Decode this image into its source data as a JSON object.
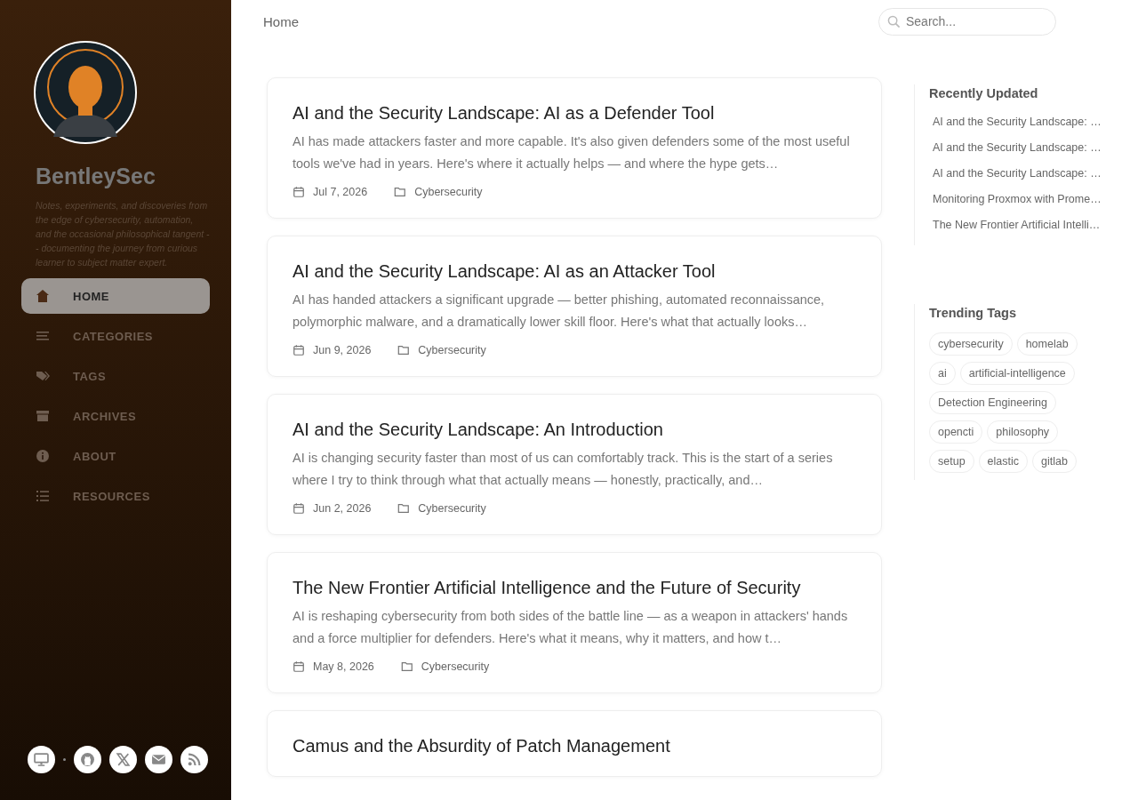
{
  "sidebar": {
    "site_title": "BentleySec",
    "tagline": "Notes, experiments, and discoveries from the edge of cybersecurity, automation, and the occasional philosophical tangent -- documenting the journey from curious learner to subject matter expert.",
    "nav": [
      {
        "kind": "home",
        "label": "HOME",
        "selected": true
      },
      {
        "kind": "categories",
        "label": "CATEGORIES",
        "selected": false
      },
      {
        "kind": "tags",
        "label": "TAGS",
        "selected": false
      },
      {
        "kind": "archives",
        "label": "ARCHIVES",
        "selected": false
      },
      {
        "kind": "about",
        "label": "ABOUT",
        "selected": false
      },
      {
        "kind": "resources",
        "label": "RESOURCES",
        "selected": false
      }
    ],
    "social": [
      {
        "kind": "theme"
      },
      {
        "kind": "github"
      },
      {
        "kind": "x"
      },
      {
        "kind": "email"
      },
      {
        "kind": "rss"
      }
    ]
  },
  "topbar": {
    "breadcrumb": "Home",
    "search": {
      "placeholder": "Search..."
    }
  },
  "posts": [
    {
      "title": "AI and the Security Landscape: AI as a Defender Tool",
      "excerpt": "AI has made attackers faster and more capable. It's also given defenders some of the most useful tools we've had in years. Here's where it actually helps — and where the hype gets…",
      "date": "Jul 7, 2026",
      "category": "Cybersecurity"
    },
    {
      "title": "AI and the Security Landscape: AI as an Attacker Tool",
      "excerpt": "AI has handed attackers a significant upgrade — better phishing, automated reconnaissance, polymorphic malware, and a dramatically lower skill floor. Here's what that actually looks…",
      "date": "Jun 9, 2026",
      "category": "Cybersecurity"
    },
    {
      "title": "AI and the Security Landscape: An Introduction",
      "excerpt": "AI is changing security faster than most of us can comfortably track. This is the start of a series where I try to think through what that actually means — honestly, practically, and…",
      "date": "Jun 2, 2026",
      "category": "Cybersecurity"
    },
    {
      "title": "The New Frontier Artificial Intelligence and the Future of Security",
      "excerpt": "AI is reshaping cybersecurity from both sides of the battle line — as a weapon in attackers' hands and a force multiplier for defenders. Here's what it means, why it matters, and how t…",
      "date": "May 8, 2026",
      "category": "Cybersecurity"
    },
    {
      "title": "Camus and the Absurdity of Patch Management"
    }
  ],
  "recently_updated": {
    "heading": "Recently Updated",
    "items": [
      "AI and the Security Landscape: …",
      "AI and the Security Landscape: …",
      "AI and the Security Landscape: …",
      "Monitoring Proxmox with Prome…",
      "The New Frontier Artificial Intelli…"
    ]
  },
  "trending_tags": {
    "heading": "Trending Tags",
    "tags": [
      "cybersecurity",
      "homelab",
      "ai",
      "artificial-intelligence",
      "Detection Engineering",
      "opencti",
      "philosophy",
      "setup",
      "elastic",
      "gitlab"
    ]
  }
}
